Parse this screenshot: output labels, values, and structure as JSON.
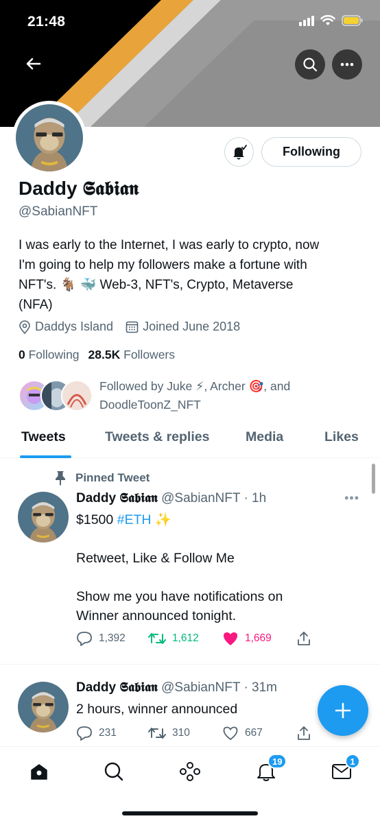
{
  "status_bar": {
    "time": "21:48"
  },
  "profile": {
    "display_name": "Daddy 𝕾𝖆𝖇𝖎𝖆𝖓",
    "handle": "@SabianNFT",
    "bio_lines": [
      "I was early to the Internet, I was early to crypto, now",
      "I'm going to help my followers make a fortune with",
      "NFT's. 🐐 🐳 Web-3, NFT's, Crypto, Metaverse",
      "(NFA)"
    ],
    "location": "Daddys Island",
    "joined": "Joined June 2018",
    "following_count": "0",
    "following_label": "Following",
    "followers_count": "28.5K",
    "followers_label": "Followers",
    "followed_by_line1": "Followed by Juke ⚡, Archer 🎯, and",
    "followed_by_line2": "DoodleToonZ_NFT",
    "following_button": "Following"
  },
  "tabs": [
    {
      "label": "Tweets",
      "active": true
    },
    {
      "label": "Tweets & replies",
      "active": false
    },
    {
      "label": "Media",
      "active": false
    },
    {
      "label": "Likes",
      "active": false
    }
  ],
  "pinned_label": "Pinned Tweet",
  "tweets": [
    {
      "name": "Daddy 𝕾𝖆𝖇𝖎𝖆𝖓",
      "handle": "@SabianNFT",
      "time": "· 1h",
      "text_prefix": "$1500 ",
      "hashtag": "#ETH",
      "text_suffix": " ✨",
      "line2": "Retweet, Like & Follow Me",
      "line3": "Show me you have notifications on",
      "line4": "Winner announced tonight.",
      "replies": "1,392",
      "retweets": "1,612",
      "likes": "1,669",
      "liked": true,
      "retweeted": true
    },
    {
      "name": "Daddy 𝕾𝖆𝖇𝖎𝖆𝖓",
      "handle": "@SabianNFT",
      "time": "· 31m",
      "text": "2 hours, winner announced",
      "replies": "231",
      "retweets": "310",
      "likes": "667"
    }
  ],
  "nav": {
    "notifications_badge": "19",
    "messages_badge": "1"
  },
  "colors": {
    "accent": "#1d9bf0",
    "like": "#f91880",
    "retweet": "#00ba7c",
    "banner_orange": "#e8a33a",
    "banner_gray": "#8e8e8e"
  }
}
